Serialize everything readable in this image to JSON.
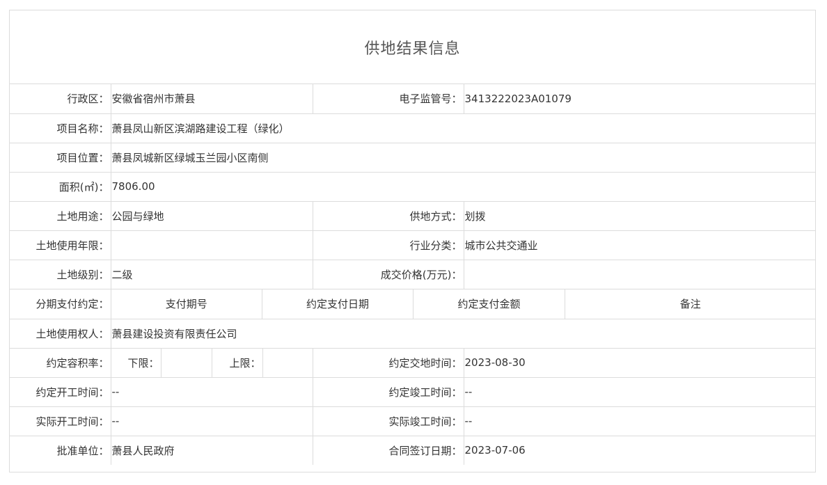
{
  "page": {
    "title": "供地结果信息"
  },
  "rows": {
    "district": {
      "label": "行政区：",
      "value": "安徽省宿州市萧县"
    },
    "supervision_no": {
      "label": "电子监管号：",
      "value": "3413222023A01079"
    },
    "project_name": {
      "label": "项目名称：",
      "value": "萧县凤山新区滨湖路建设工程（绿化）"
    },
    "project_location": {
      "label": "项目位置：",
      "value": "萧县凤城新区绿城玉兰园小区南侧"
    },
    "area": {
      "label": "面积(㎡)：",
      "value": "7806.00"
    },
    "land_use": {
      "label": "土地用途：",
      "value": "公园与绿地"
    },
    "supply_method": {
      "label": "供地方式：",
      "value": "划拨"
    },
    "use_term": {
      "label": "土地使用年限：",
      "value": ""
    },
    "industry": {
      "label": "行业分类：",
      "value": "城市公共交通业"
    },
    "land_grade": {
      "label": "土地级别：",
      "value": "二级"
    },
    "deal_price": {
      "label": "成交价格(万元)：",
      "value": ""
    },
    "installment": {
      "label": "分期支付约定：",
      "headers": [
        "支付期号",
        "约定支付日期",
        "约定支付金额",
        "备注"
      ]
    },
    "land_user": {
      "label": "土地使用权人：",
      "value": "萧县建设投资有限责任公司"
    },
    "plot_ratio": {
      "label": "约定容积率：",
      "lower_label": "下限：",
      "lower_value": "",
      "upper_label": "上限：",
      "upper_value": ""
    },
    "handover_time": {
      "label": "约定交地时间：",
      "value": "2023-08-30"
    },
    "agreed_start": {
      "label": "约定开工时间：",
      "value": "--"
    },
    "agreed_completion": {
      "label": "约定竣工时间：",
      "value": "--"
    },
    "actual_start": {
      "label": "实际开工时间：",
      "value": "--"
    },
    "actual_completion": {
      "label": "实际竣工时间：",
      "value": "--"
    },
    "approval_unit": {
      "label": "批准单位：",
      "value": "萧县人民政府"
    },
    "contract_date": {
      "label": "合同签订日期：",
      "value": "2023-07-06"
    }
  }
}
